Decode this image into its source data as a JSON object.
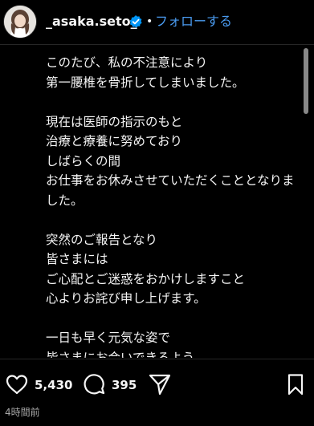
{
  "header": {
    "username": "_asaka.seto_",
    "separator": "•",
    "follow_label": "フォローする",
    "avatar_icon": "profile-photo-icon",
    "verified_icon": "verified-badge-icon",
    "accent_color": "#4a9bf0"
  },
  "caption": {
    "paragraphs": [
      "このたび、私の不注意により\n第一腰椎を骨折してしまいました。",
      "現在は医師の指示のもと\n治療と療養に努めており\nしばらくの間\nお仕事をお休みさせていただくこととなりました。",
      "突然のご報告となり\n皆さまには\nご心配とご迷惑をおかけしますこと\n心よりお詫び申し上げます。",
      "一日も早く元気な姿で\n皆さまにお会いできるよう\n今は治療と療養に専念してまいります。"
    ]
  },
  "actions": {
    "like_icon": "heart-icon",
    "like_count": "5,430",
    "comment_icon": "comment-icon",
    "comment_count": "395",
    "share_icon": "share-icon",
    "save_icon": "bookmark-icon"
  },
  "timestamp": "4時間前"
}
